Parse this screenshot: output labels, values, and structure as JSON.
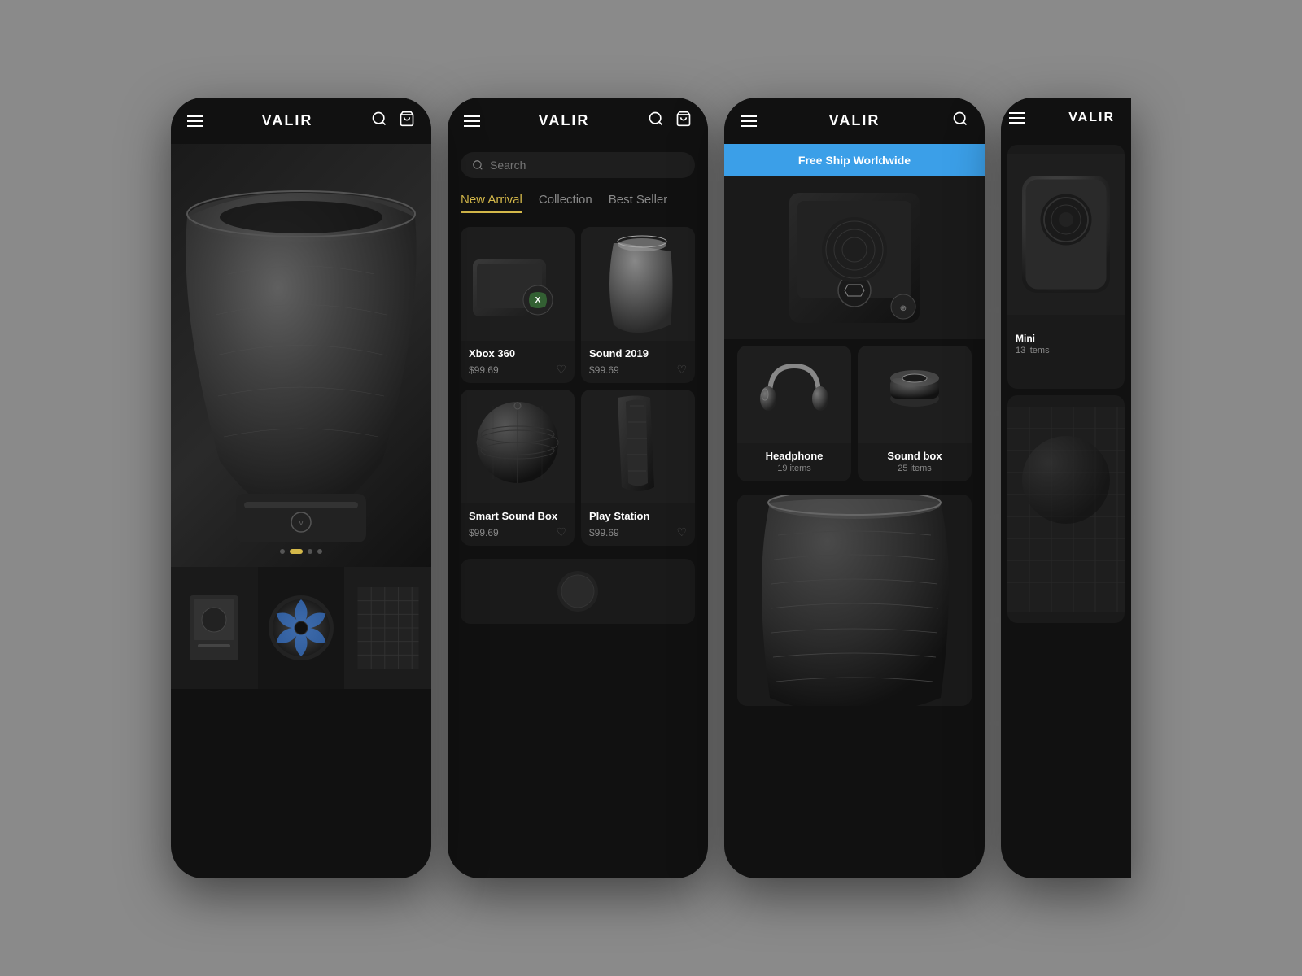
{
  "app": {
    "name": "VALIR",
    "background": "#8a8a8a"
  },
  "phone1": {
    "title": "VALIR",
    "carousel_dots": [
      false,
      true,
      false,
      false
    ],
    "thumbnails": [
      "speaker-product",
      "fan-product"
    ]
  },
  "phone2": {
    "title": "VALIR",
    "search_placeholder": "Search",
    "tabs": [
      {
        "label": "New Arrival",
        "active": true
      },
      {
        "label": "Collection",
        "active": false
      },
      {
        "label": "Best Seller",
        "active": false
      }
    ],
    "products": [
      {
        "name": "Xbox 360",
        "price": "$99.69"
      },
      {
        "name": "Sound 2019",
        "price": "$99.69"
      },
      {
        "name": "Smart Sound Box",
        "price": "$99.69"
      },
      {
        "name": "Play Station",
        "price": "$99.69"
      }
    ]
  },
  "phone3": {
    "title": "VALIR",
    "banner": "Free Ship Worldwide",
    "banner_color": "#3b9fe8",
    "collections": [
      {
        "name": "Headphone",
        "count": "19 items"
      },
      {
        "name": "Sound box",
        "count": "25 items"
      }
    ]
  },
  "phone4_partial": {
    "title": "VALIR",
    "partial_items": [
      {
        "name": "Mini",
        "count": "13 items"
      }
    ]
  }
}
